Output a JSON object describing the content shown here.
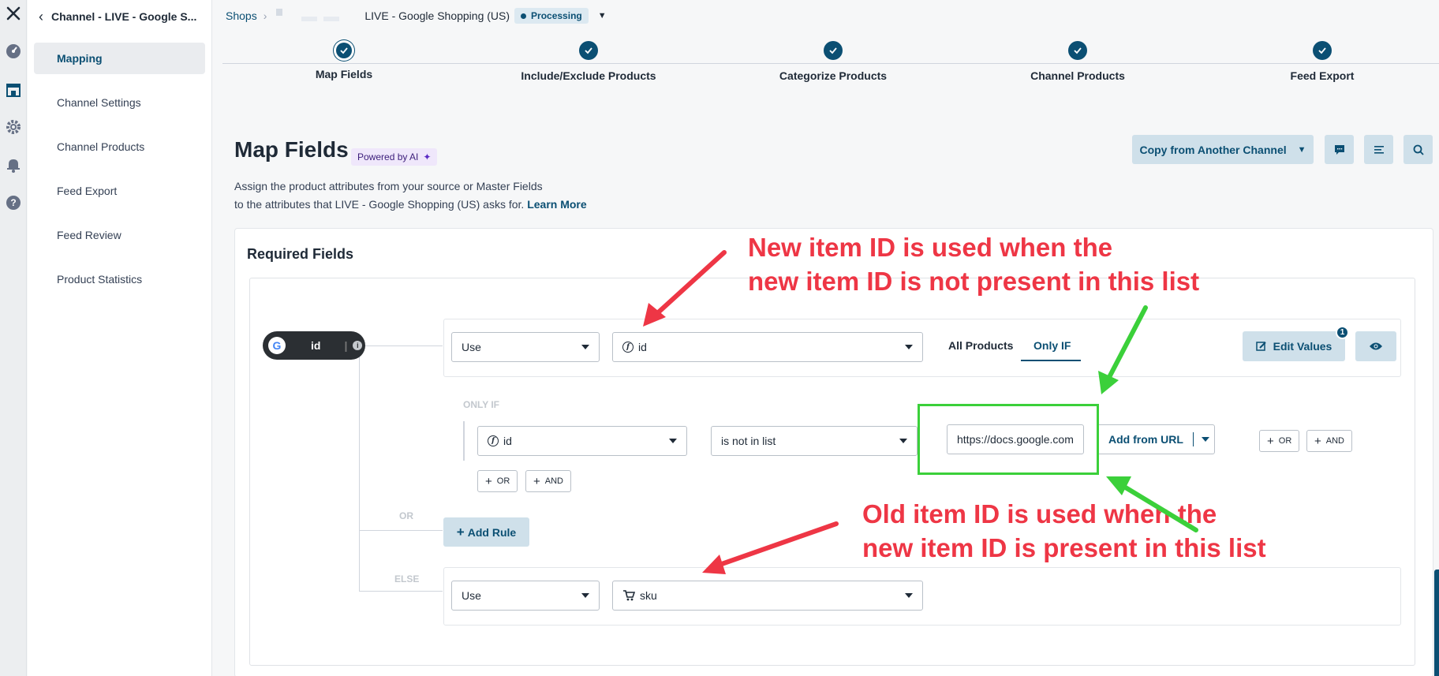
{
  "sidebar": {
    "title": "Channel - LIVE - Google S...",
    "items": [
      {
        "label": "Mapping"
      },
      {
        "label": "Channel Settings"
      },
      {
        "label": "Channel Products"
      },
      {
        "label": "Feed Export"
      },
      {
        "label": "Feed Review"
      },
      {
        "label": "Product Statistics"
      }
    ]
  },
  "topbar": {
    "breadcrumb": "Shops",
    "shop_name": "LIVE - Google Shopping (US)",
    "status": "Processing"
  },
  "steps": [
    {
      "label": "Map Fields",
      "current": true
    },
    {
      "label": "Include/Exclude Products"
    },
    {
      "label": "Categorize Products"
    },
    {
      "label": "Channel Products"
    },
    {
      "label": "Feed Export"
    }
  ],
  "header": {
    "title": "Map Fields",
    "ai_badge": "Powered by AI",
    "desc_line1": "Assign the product attributes from your source or Master Fields",
    "desc_line2": "to the attributes that LIVE - Google Shopping (US) asks for.",
    "learn_more": "Learn More",
    "copy_button": "Copy from Another Channel"
  },
  "card": {
    "title": "Required Fields",
    "field": {
      "google_letter": "G",
      "name": "id"
    },
    "rule": {
      "use_label": "Use",
      "value": "id",
      "tab_all": "All Products",
      "tab_only_if": "Only IF",
      "edit_values": "Edit Values",
      "edit_count": "1"
    },
    "only_if": {
      "label": "ONLY IF",
      "field": "id",
      "operator": "is not in list",
      "url_value": "https://docs.google.com",
      "add_from_url": "Add from URL",
      "or_label": "OR",
      "and_label": "AND"
    },
    "or_label": "OR",
    "add_rule": "Add Rule",
    "else": {
      "label": "ELSE",
      "use_label": "Use",
      "value": "sku"
    }
  },
  "annotations": {
    "top_line1": "New item ID is used when the",
    "top_line2": "new item ID is not present in this list",
    "bottom_line1": "Old item ID is used when the",
    "bottom_line2": "new item ID is present in this list"
  },
  "colors": {
    "primary": "#0b4f73",
    "annotation_red": "#ee3645",
    "annotation_green": "#3bd03a"
  }
}
